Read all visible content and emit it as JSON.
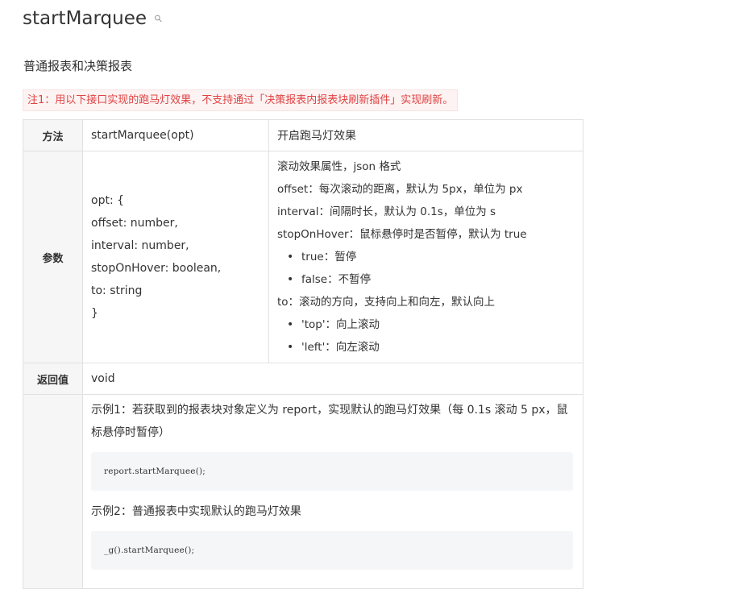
{
  "heading": {
    "title": "startMarquee",
    "anchor_icon": "link-icon"
  },
  "subtitle": "普通报表和决策报表",
  "note": "注1：用以下接口实现的跑马灯效果，不支持通过「决策报表内报表块刷新插件」实现刷新。",
  "table": {
    "method": {
      "label": "方法",
      "name": "startMarquee(opt)",
      "desc": "开启跑马灯效果"
    },
    "params": {
      "label": "参数",
      "code_lines": [
        "opt: {",
        "offset: number,",
        "interval: number,",
        "stopOnHover: boolean,",
        "to: string",
        "}"
      ],
      "desc_lines": [
        "滚动效果属性，json 格式",
        "offset：每次滚动的距离，默认为 5px，单位为 px",
        "interval：间隔时长，默认为 0.1s，单位为 s",
        "stopOnHover：鼠标悬停时是否暂停，默认为 true"
      ],
      "hover_items": [
        "true：暂停",
        "false：不暂停"
      ],
      "to_line": "to：滚动的方向，支持向上和向左，默认向上",
      "to_items": [
        "'top'：向上滚动",
        "'left'：向左滚动"
      ]
    },
    "returns": {
      "label": "返回值",
      "value": "void"
    },
    "examples": {
      "ex1_text": "示例1：若获取到的报表块对象定义为 report，实现默认的跑马灯效果（每 0.1s 滚动 5 px，鼠标悬停时暂停）",
      "ex1_code": "report.startMarquee();",
      "ex2_text": "示例2：普通报表中实现默认的跑马灯效果",
      "ex2_code": "_g().startMarquee();"
    }
  }
}
